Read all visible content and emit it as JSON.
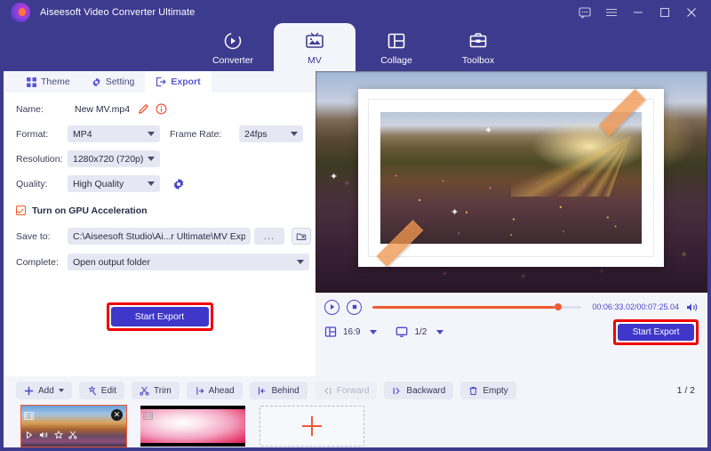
{
  "window": {
    "title": "Aiseesoft Video Converter Ultimate",
    "controls": {
      "feedback": "feedback-icon",
      "menu": "menu-icon",
      "minimize": "minimize-icon",
      "maximize": "maximize-icon",
      "close": "close-icon"
    }
  },
  "topnav": {
    "items": [
      {
        "label": "Converter",
        "icon": "converter-icon",
        "active": false
      },
      {
        "label": "MV",
        "icon": "mv-icon",
        "active": true
      },
      {
        "label": "Collage",
        "icon": "collage-icon",
        "active": false
      },
      {
        "label": "Toolbox",
        "icon": "toolbox-icon",
        "active": false
      }
    ]
  },
  "tabs": [
    {
      "label": "Theme",
      "icon": "grid-icon",
      "active": false
    },
    {
      "label": "Setting",
      "icon": "gear-icon",
      "active": false
    },
    {
      "label": "Export",
      "icon": "export-icon",
      "active": true
    }
  ],
  "form": {
    "name_label": "Name:",
    "name_value": "New MV.mp4",
    "edit_icon": "pencil-icon",
    "info_icon": "info-icon",
    "format_label": "Format:",
    "format_value": "MP4",
    "framerate_label": "Frame Rate:",
    "framerate_value": "24fps",
    "resolution_label": "Resolution:",
    "resolution_value": "1280x720 (720p)",
    "quality_label": "Quality:",
    "quality_value": "High Quality",
    "quality_settings_icon": "gear-icon",
    "gpu_label": "Turn on GPU Acceleration",
    "gpu_checked": true,
    "saveto_label": "Save to:",
    "saveto_value": "C:\\Aiseesoft Studio\\Ai...r Ultimate\\MV Exported",
    "browse_label": "...",
    "folder_icon": "folder-icon",
    "complete_label": "Complete:",
    "complete_value": "Open output folder",
    "start_export_label": "Start Export"
  },
  "player": {
    "play_icon": "play-icon",
    "stop_icon": "stop-icon",
    "timecode": "00:06:33.02/00:07:25.04",
    "volume_icon": "volume-icon",
    "progress_percent": 87,
    "aspect_icon": "aspect-ratio-icon",
    "aspect_value": "16:9",
    "screen_icon": "monitor-icon",
    "zoom_value": "1/2",
    "start_export_label": "Start Export"
  },
  "toolbar": {
    "buttons": [
      {
        "label": "Add",
        "icon": "plus-icon",
        "has_caret": true,
        "disabled": false
      },
      {
        "label": "Edit",
        "icon": "magic-wand-icon",
        "has_caret": false,
        "disabled": false
      },
      {
        "label": "Trim",
        "icon": "scissors-icon",
        "has_caret": false,
        "disabled": false
      },
      {
        "label": "Ahead",
        "icon": "insert-ahead-icon",
        "has_caret": false,
        "disabled": false
      },
      {
        "label": "Behind",
        "icon": "insert-behind-icon",
        "has_caret": false,
        "disabled": false
      },
      {
        "label": "Forward",
        "icon": "move-forward-icon",
        "has_caret": false,
        "disabled": true
      },
      {
        "label": "Backward",
        "icon": "move-backward-icon",
        "has_caret": false,
        "disabled": false
      },
      {
        "label": "Empty",
        "icon": "trash-icon",
        "has_caret": false,
        "disabled": false
      }
    ],
    "page_count": "1 / 2"
  },
  "thumbnails": {
    "items": [
      {
        "selected": true,
        "close_label": "✕",
        "tools": [
          "play-icon",
          "volume-icon",
          "effect-icon",
          "trim-icon"
        ]
      },
      {
        "selected": false
      }
    ],
    "add_label": "add-media-placeholder"
  },
  "colors": {
    "header": "#3d3b8e",
    "panel": "#f4f5fb",
    "accent": "#3f37c9",
    "orange": "#ef5a33",
    "annotation_red": "#f00000"
  }
}
